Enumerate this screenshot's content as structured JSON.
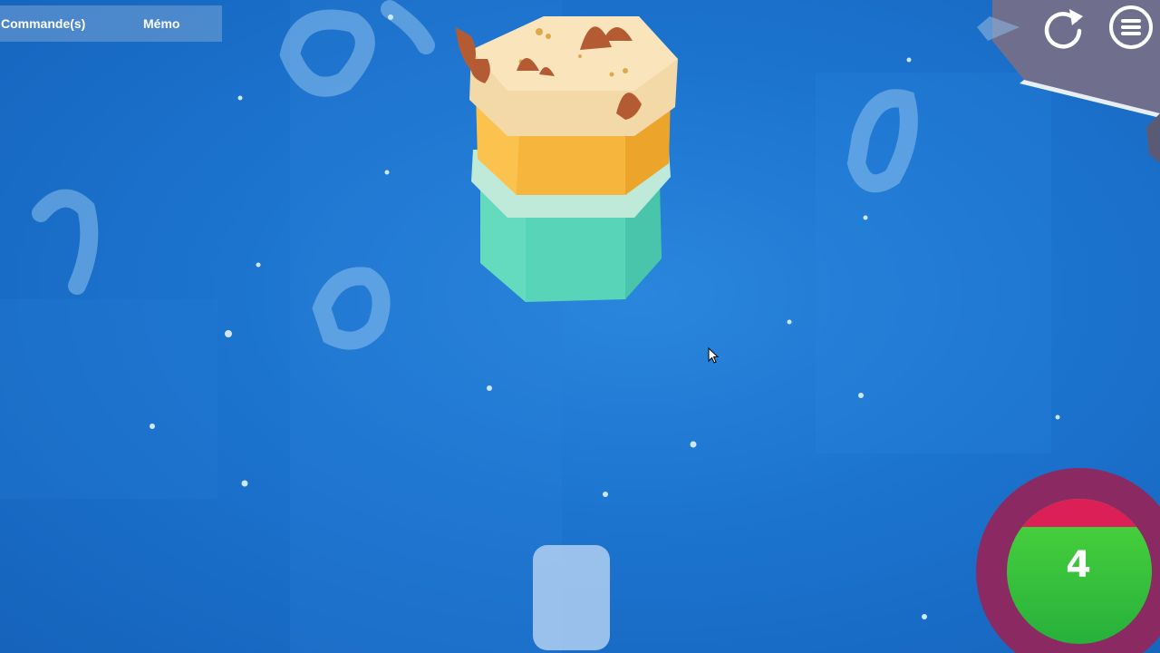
{
  "tabs": {
    "commands_label": "Commande(s)",
    "memo_label": "Mémo"
  },
  "toolbar": {
    "restart_icon": "restart-icon",
    "menu_icon": "hamburger-menu-icon"
  },
  "score": {
    "value": "4",
    "outer_ring_color": "#8b2a62",
    "top_band_color": "#dd1f57",
    "fill_color": "#3ec93a"
  },
  "cake": {
    "layers": [
      "sand-topping",
      "orange",
      "mint-rim",
      "teal"
    ],
    "colors": {
      "top": "#f3d9a8",
      "orange": "#f6b63e",
      "mint": "#bfe9d9",
      "teal": "#58d4b9",
      "spikes": "#b55b34"
    }
  },
  "slot": {
    "color": "#bdd7f5"
  }
}
